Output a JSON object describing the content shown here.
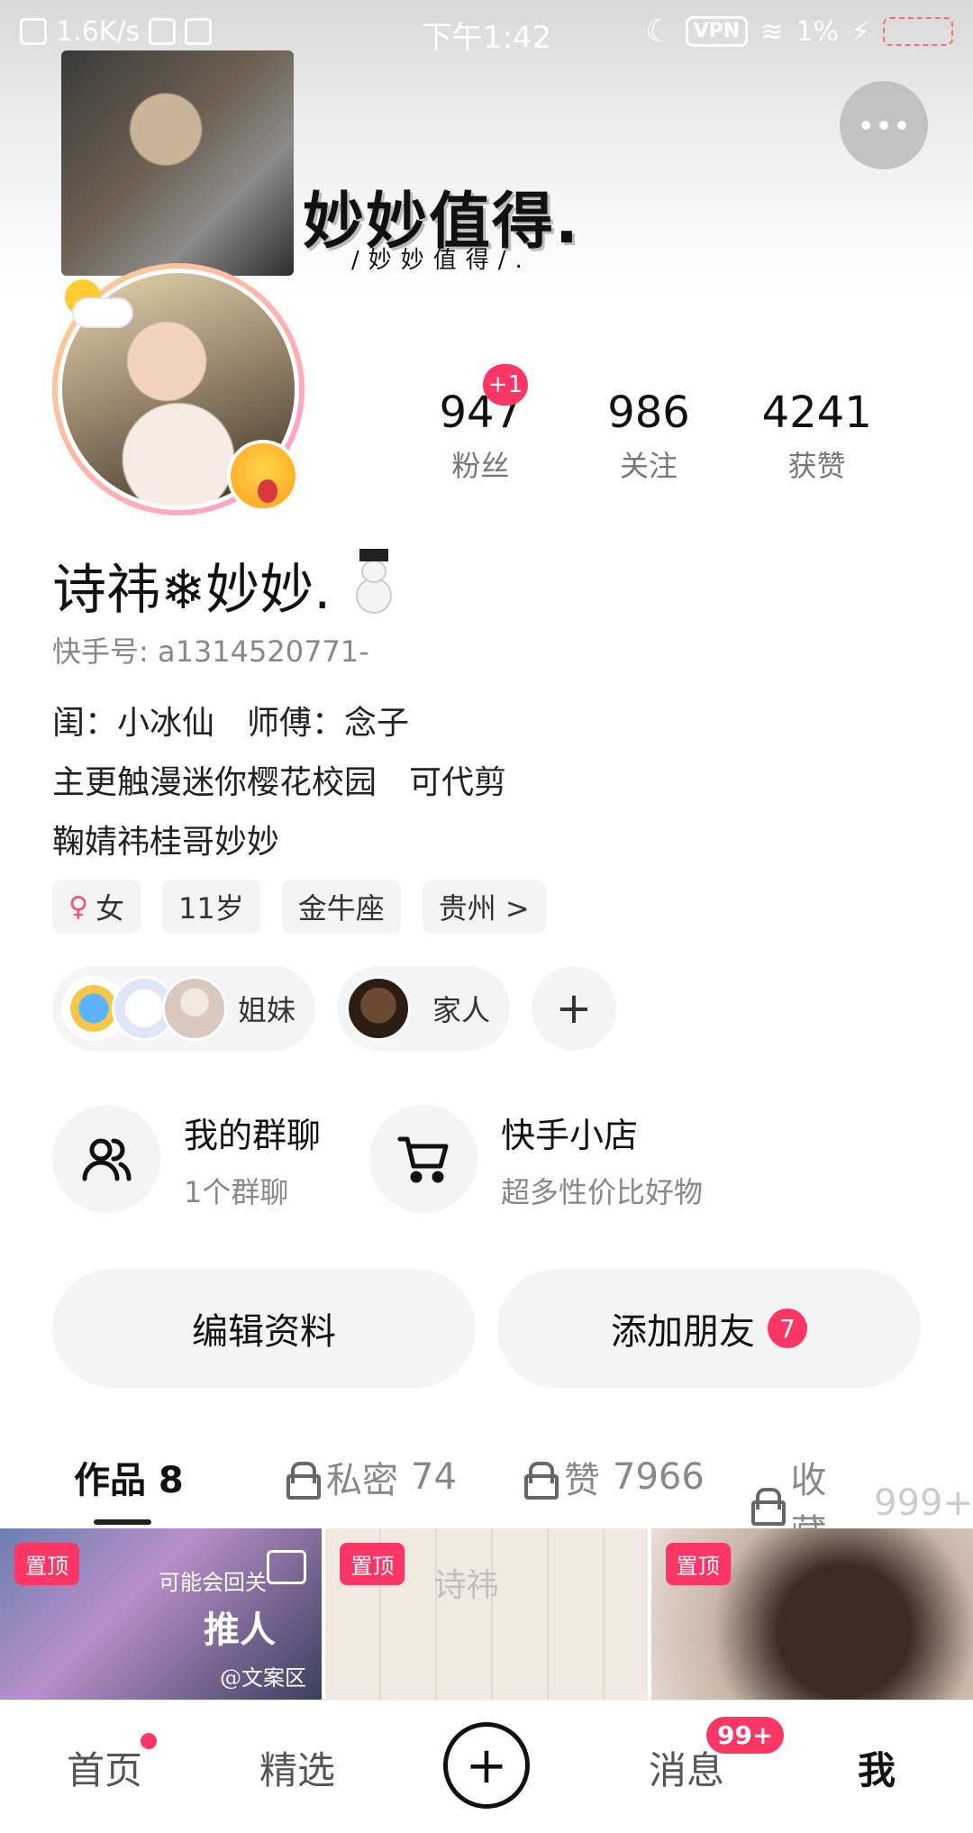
{
  "status_bar": {
    "speed": "1.6K/s",
    "time": "下午1:42",
    "vpn": "VPN",
    "battery": "1%"
  },
  "header": {
    "cover_title": "妙妙值得.",
    "cover_subtitle": "/妙妙值得/."
  },
  "stats": [
    {
      "value": "947",
      "label": "粉丝"
    },
    {
      "value": "986",
      "label": "关注"
    },
    {
      "value": "4241",
      "label": "获赞"
    }
  ],
  "fans_badge": "+1",
  "profile": {
    "name": "诗祎❄妙妙.",
    "user_id": "快手号: a1314520771-",
    "bio_lines": [
      "闺：小冰仙　师傅：念子",
      "主更触漫迷你樱花校园　可代剪",
      "鞠婧祎桂哥妙妙"
    ]
  },
  "tags": [
    "女",
    "11岁",
    "金牛座",
    "贵州 >"
  ],
  "groups": {
    "sisters": "姐妹",
    "family": "家人",
    "add": "+"
  },
  "entries": {
    "group_chat": {
      "title": "我的群聊",
      "sub": "1个群聊"
    },
    "shop": {
      "title": "快手小店",
      "sub": "超多性价比好物"
    }
  },
  "actions": {
    "edit": "编辑资料",
    "add_friend": "添加朋友",
    "add_friend_count": "7"
  },
  "tabs": {
    "works": "作品 8",
    "private_label": "私密",
    "private_count": "74",
    "likes_label": "赞",
    "likes_count": "7966",
    "fav_label": "收藏",
    "fav_count": "999+"
  },
  "grid": {
    "pin": "置顶",
    "t1_line1": "可能会回关",
    "t1_line2": "推人",
    "t1_line3": "@文案区",
    "t2_watermark": "诗祎"
  },
  "bottom_nav": {
    "home": "首页",
    "featured": "精选",
    "plus": "+",
    "messages": "消息",
    "messages_badge": "99+",
    "me": "我"
  },
  "colors": {
    "accent": "#fe3666"
  }
}
